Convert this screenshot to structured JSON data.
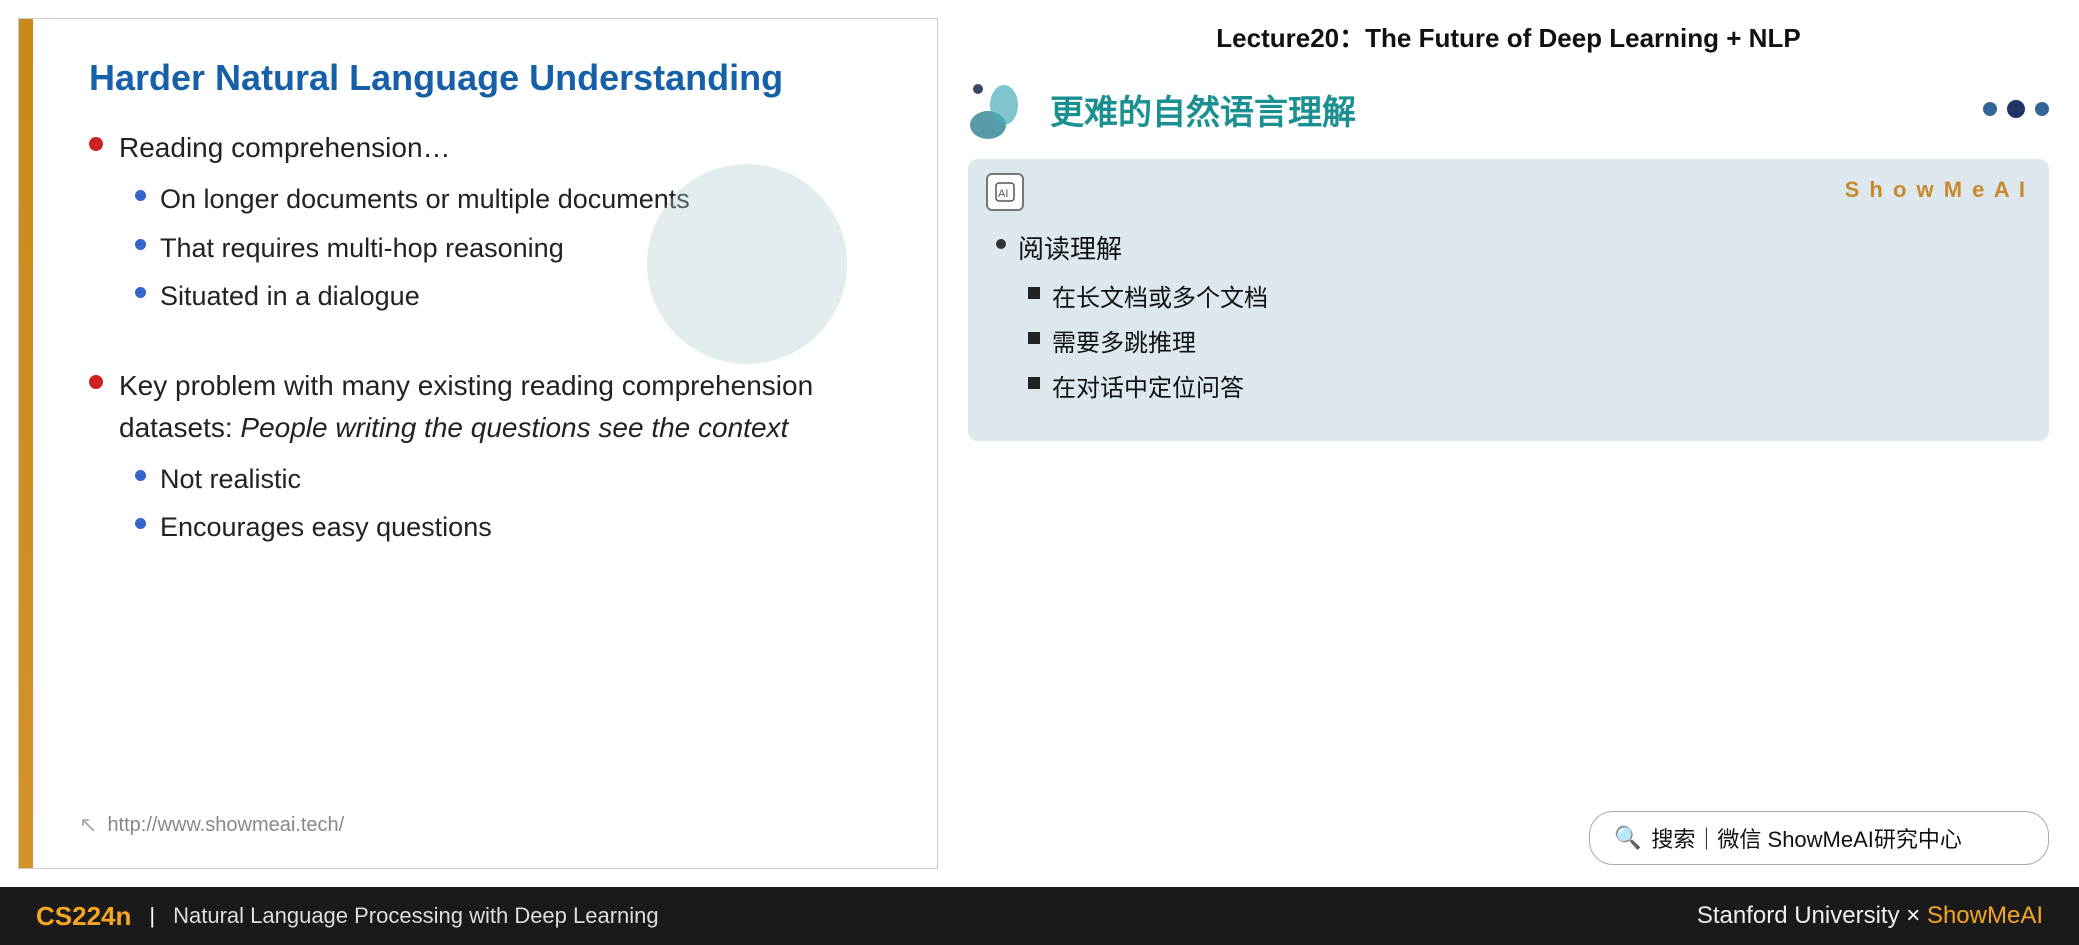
{
  "slide": {
    "title": "Harder Natural Language Understanding",
    "left_border_color": "#c8891a",
    "circle_decoration": true,
    "bullets": [
      {
        "text": "Reading comprehension…",
        "sub_bullets": [
          "On longer documents or multiple documents",
          "That requires multi-hop reasoning",
          "Situated in a dialogue"
        ]
      },
      {
        "text": "Key problem with many existing reading comprehension datasets: ",
        "text_italic": "People writing the questions see the context",
        "sub_bullets": [
          "Not realistic",
          "Encourages easy questions"
        ]
      }
    ],
    "footer_url": "http://www.showmeai.tech/"
  },
  "right_panel": {
    "lecture_title": "Lecture20：The Future of Deep Learning + NLP",
    "title_chinese": "更难的自然语言理解",
    "brand": "ShowMeAI",
    "dots": [
      "inactive",
      "active",
      "inactive"
    ],
    "card": {
      "ai_label": "AI",
      "brand_label": "S h o w M e A I",
      "main_bullet": "阅读理解",
      "sub_bullets": [
        "在长文档或多个文档",
        "需要多跳推理",
        "在对话中定位问答"
      ]
    },
    "search_placeholder": "搜索｜微信 ShowMeAI研究中心"
  },
  "bottom_bar": {
    "course": "CS224n",
    "divider": "|",
    "subtitle": "Natural Language Processing with Deep Learning",
    "university": "Stanford University",
    "x_symbol": "✕",
    "brand": "ShowMeAI"
  }
}
